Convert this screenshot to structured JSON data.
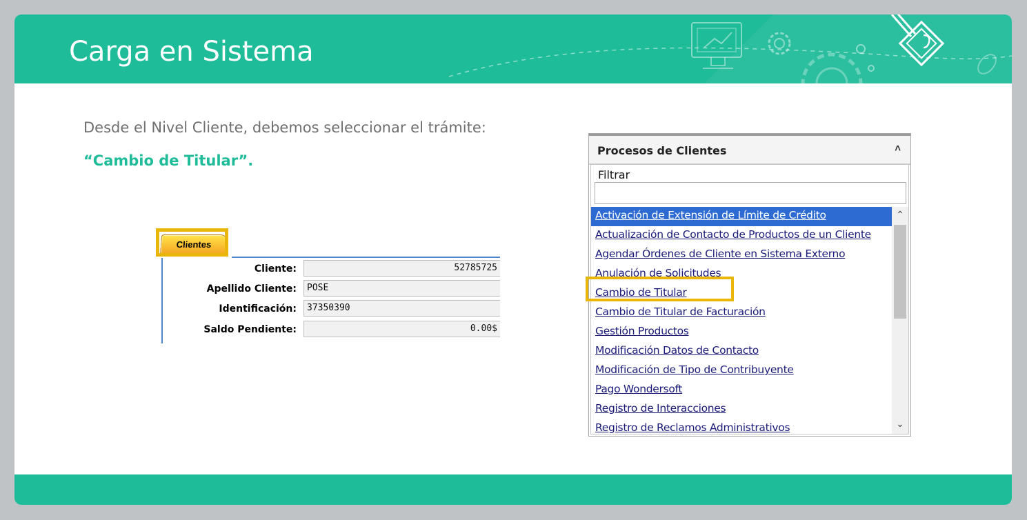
{
  "slide": {
    "title": "Carga en Sistema",
    "instruction": "Desde el Nivel Cliente, debemos seleccionar el trámite:",
    "instruction_bold": "“Cambio de Titular”.",
    "colors": {
      "accent": "#1ebc99",
      "highlight": "#e8b70a",
      "selected": "#2d6ad2"
    }
  },
  "client_panel": {
    "tab_label": "Clientes",
    "fields": [
      {
        "label": "Cliente:",
        "value": "52785725"
      },
      {
        "label": "Apellido Cliente:",
        "value": "POSE"
      },
      {
        "label": "Identificación:",
        "value": "37350390"
      },
      {
        "label": "Saldo Pendiente:",
        "value": "0.00$"
      }
    ]
  },
  "process_panel": {
    "title": "Procesos de Clientes",
    "collapse_icon": "double-chevron-up-icon",
    "filter_label": "Filtrar",
    "filter_value": "",
    "items": [
      "Activación de Extensión de Límite de Crédito",
      "Actualización de Contacto de Productos de un Cliente",
      "Agendar Órdenes de Cliente en Sistema Externo",
      "Anulación de Solicitudes",
      "Cambio de Titular",
      "Cambio de Titular de Facturación",
      "Gestión Productos",
      "Modificación Datos de Contacto",
      "Modificación de Tipo de Contribuyente",
      "Pago Wondersoft",
      "Registro de Interacciones",
      "Registro de Reclamos Administrativos"
    ],
    "selected_item": "Activación de Extensión de Límite de Crédito",
    "highlighted_item": "Cambio de Titular"
  }
}
